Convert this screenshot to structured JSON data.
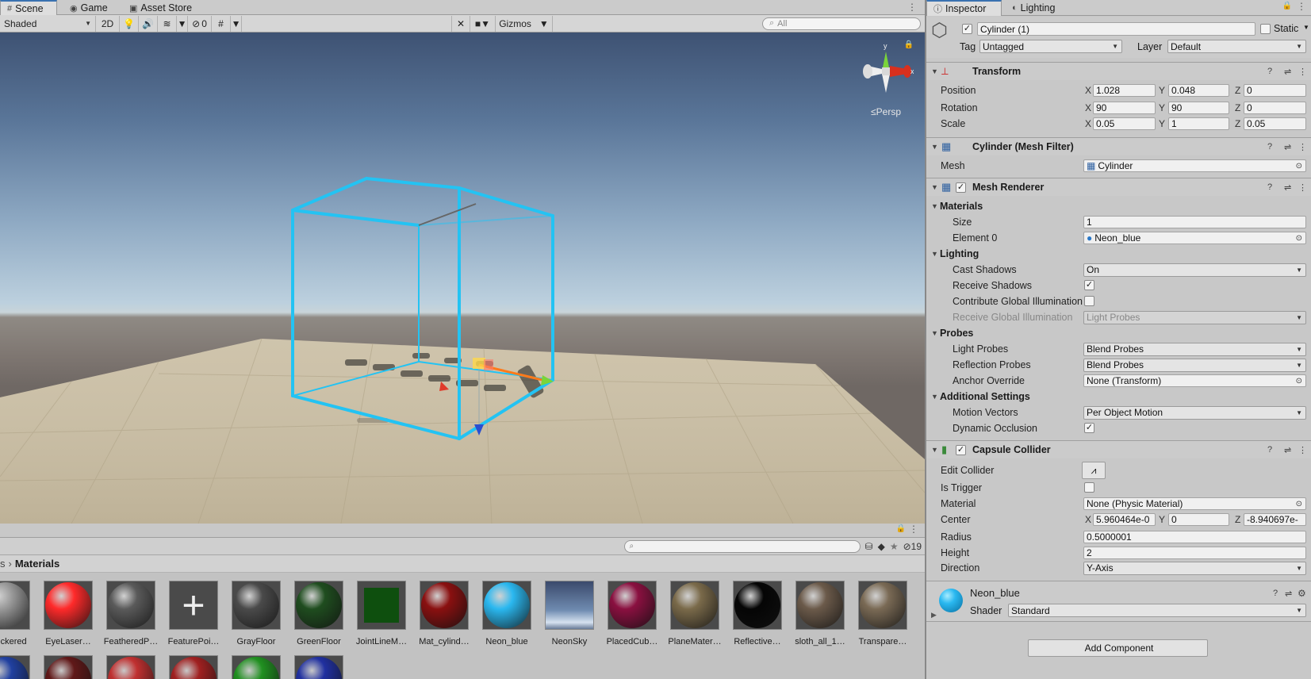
{
  "scene_tabs": [
    {
      "label": "Scene",
      "icon": "grid-icon"
    },
    {
      "label": "Game",
      "icon": "gamepad-icon"
    },
    {
      "label": "Asset Store",
      "icon": "bag-icon"
    }
  ],
  "scene_toolbar": {
    "draw_mode": "Shaded",
    "mode_2d": "2D",
    "hidden_count": "0",
    "gizmos": "Gizmos",
    "search_placeholder": "All"
  },
  "viewport": {
    "persp": "Persp",
    "axis_y": "y",
    "axis_x": "x"
  },
  "project": {
    "breadcrumb_prev": "s",
    "breadcrumb_current": "Materials",
    "hidden_count": "19",
    "assets_row1": [
      {
        "name": "Checkered",
        "color": "#9a9a9a"
      },
      {
        "name": "EyeLaser…",
        "color": "#ff2a2a"
      },
      {
        "name": "FeatheredP…",
        "color": "#5a5a5a"
      },
      {
        "name": "FeaturePoi…",
        "color": "#5a5a5a"
      },
      {
        "name": "GrayFloor",
        "color": "#4a4a4a"
      },
      {
        "name": "GreenFloor",
        "color": "#1f4d1f"
      },
      {
        "name": "JointLineM…",
        "color": "#0e4f0e"
      },
      {
        "name": "Mat_cylind…",
        "color": "#8a1010"
      },
      {
        "name": "Neon_blue",
        "color": "#2ab8f0"
      },
      {
        "name": "NeonSky",
        "color": "#5a7090"
      },
      {
        "name": "PlacedCub…",
        "color": "#8a1040"
      },
      {
        "name": "PlaneMater…",
        "color": "#7a6a4a"
      },
      {
        "name": "Reflective…",
        "color": "#050505"
      },
      {
        "name": "sloth_all_1…",
        "color": "#6b5a4a"
      },
      {
        "name": "Transpare…",
        "color": "#7a6a55"
      }
    ],
    "assets_row2": [
      "#2040a0",
      "#601818",
      "#c03030",
      "#a02020",
      "#209020",
      "#2030a0"
    ]
  },
  "inspector": {
    "tabs": [
      "Inspector",
      "Lighting"
    ],
    "object_name": "Cylinder (1)",
    "static": "Static",
    "tag_label": "Tag",
    "tag": "Untagged",
    "layer_label": "Layer",
    "layer": "Default",
    "transform": {
      "title": "Transform",
      "position_label": "Position",
      "position": [
        "1.028",
        "0.048",
        "0"
      ],
      "rotation_label": "Rotation",
      "rotation": [
        "90",
        "90",
        "0"
      ],
      "scale_label": "Scale",
      "scale": [
        "0.05",
        "1",
        "0.05"
      ]
    },
    "mesh_filter": {
      "title": "Cylinder (Mesh Filter)",
      "mesh_label": "Mesh",
      "mesh": "Cylinder"
    },
    "mesh_renderer": {
      "title": "Mesh Renderer",
      "materials": "Materials",
      "size_label": "Size",
      "size": "1",
      "element0_label": "Element 0",
      "element0": "Neon_blue",
      "lighting": "Lighting",
      "cast_shadows_label": "Cast Shadows",
      "cast_shadows": "On",
      "receive_shadows_label": "Receive Shadows",
      "contribute_gi_label": "Contribute Global Illumination",
      "receive_gi_label": "Receive Global Illumination",
      "receive_gi": "Light Probes",
      "probes": "Probes",
      "light_probes_label": "Light Probes",
      "light_probes": "Blend Probes",
      "reflection_probes_label": "Reflection Probes",
      "reflection_probes": "Blend Probes",
      "anchor_label": "Anchor Override",
      "anchor": "None (Transform)",
      "additional": "Additional Settings",
      "motion_vectors_label": "Motion Vectors",
      "motion_vectors": "Per Object Motion",
      "dynamic_occlusion_label": "Dynamic Occlusion"
    },
    "capsule": {
      "title": "Capsule Collider",
      "edit_label": "Edit Collider",
      "trigger_label": "Is Trigger",
      "material_label": "Material",
      "material": "None (Physic Material)",
      "center_label": "Center",
      "center": [
        "5.960464e-0",
        "0",
        "-8.940697e-"
      ],
      "radius_label": "Radius",
      "radius": "0.5000001",
      "height_label": "Height",
      "height": "2",
      "direction_label": "Direction",
      "direction": "Y-Axis"
    },
    "material": {
      "name": "Neon_blue",
      "shader_label": "Shader",
      "shader": "Standard"
    },
    "add_component": "Add Component"
  }
}
